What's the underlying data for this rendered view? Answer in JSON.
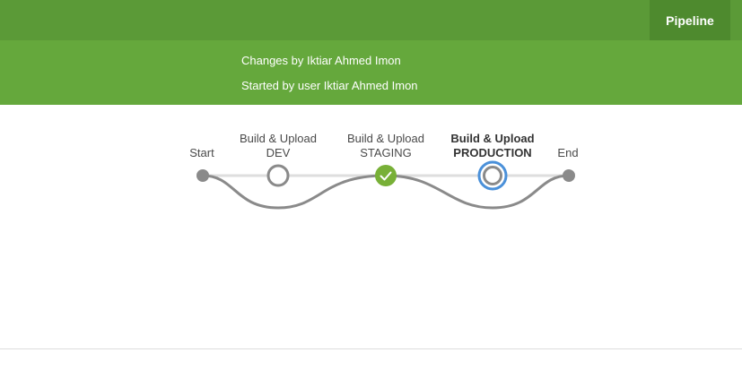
{
  "header": {
    "tab_pipeline": "Pipeline"
  },
  "info": {
    "changes": "Changes by Iktiar Ahmed Imon",
    "started": "Started by user Iktiar Ahmed Imon"
  },
  "pipeline": {
    "start_label": "Start",
    "end_label": "End",
    "stages": [
      {
        "line1": "Build & Upload",
        "line2": "DEV",
        "status": "not-built"
      },
      {
        "line1": "Build & Upload",
        "line2": "STAGING",
        "status": "success"
      },
      {
        "line1": "Build & Upload",
        "line2": "PRODUCTION",
        "status": "in-progress"
      }
    ]
  },
  "colors": {
    "header": "#5b9a37",
    "header_tab": "#4e8a2e",
    "info_bar": "#65a83c",
    "success": "#78b037",
    "in_progress": "#4a90d9",
    "connector": "#8a8a8a"
  }
}
